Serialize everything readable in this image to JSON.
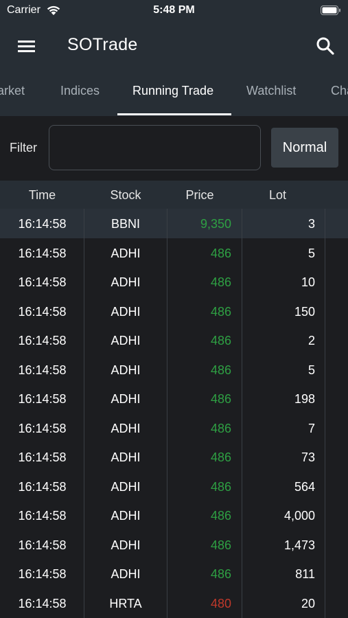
{
  "status_bar": {
    "carrier": "Carrier",
    "time": "5:48 PM"
  },
  "app": {
    "title": "SOTrade"
  },
  "tabs": [
    {
      "label": "Market"
    },
    {
      "label": "Indices"
    },
    {
      "label": "Running Trade"
    },
    {
      "label": "Watchlist"
    },
    {
      "label": "Chart"
    }
  ],
  "filter": {
    "label": "Filter",
    "value": "",
    "mode_button": "Normal"
  },
  "columns": [
    "Time",
    "Stock",
    "Price",
    "Lot"
  ],
  "colors": {
    "up": "#2ea043",
    "down": "#c0392b",
    "background": "#1c1d20",
    "header": "#272e35"
  },
  "trades": [
    {
      "time": "16:14:58",
      "stock": "BBNI",
      "price": "9,350",
      "lot": "3",
      "direction": "up"
    },
    {
      "time": "16:14:58",
      "stock": "ADHI",
      "price": "486",
      "lot": "5",
      "direction": "up"
    },
    {
      "time": "16:14:58",
      "stock": "ADHI",
      "price": "486",
      "lot": "10",
      "direction": "up"
    },
    {
      "time": "16:14:58",
      "stock": "ADHI",
      "price": "486",
      "lot": "150",
      "direction": "up"
    },
    {
      "time": "16:14:58",
      "stock": "ADHI",
      "price": "486",
      "lot": "2",
      "direction": "up"
    },
    {
      "time": "16:14:58",
      "stock": "ADHI",
      "price": "486",
      "lot": "5",
      "direction": "up"
    },
    {
      "time": "16:14:58",
      "stock": "ADHI",
      "price": "486",
      "lot": "198",
      "direction": "up"
    },
    {
      "time": "16:14:58",
      "stock": "ADHI",
      "price": "486",
      "lot": "7",
      "direction": "up"
    },
    {
      "time": "16:14:58",
      "stock": "ADHI",
      "price": "486",
      "lot": "73",
      "direction": "up"
    },
    {
      "time": "16:14:58",
      "stock": "ADHI",
      "price": "486",
      "lot": "564",
      "direction": "up"
    },
    {
      "time": "16:14:58",
      "stock": "ADHI",
      "price": "486",
      "lot": "4,000",
      "direction": "up"
    },
    {
      "time": "16:14:58",
      "stock": "ADHI",
      "price": "486",
      "lot": "1,473",
      "direction": "up"
    },
    {
      "time": "16:14:58",
      "stock": "ADHI",
      "price": "486",
      "lot": "811",
      "direction": "up"
    },
    {
      "time": "16:14:58",
      "stock": "HRTA",
      "price": "480",
      "lot": "20",
      "direction": "down"
    }
  ]
}
